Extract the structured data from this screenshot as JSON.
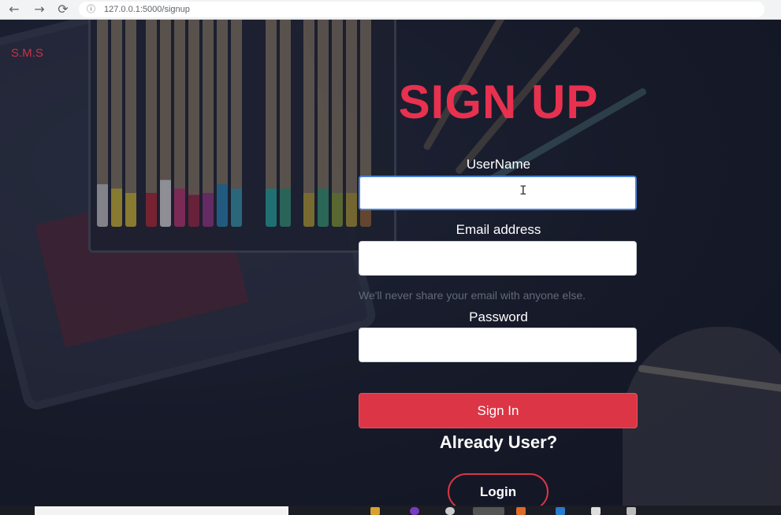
{
  "browser": {
    "url": "127.0.0.1:5000/signup",
    "back_icon": "←",
    "forward_icon": "→",
    "reload_icon": "⟳",
    "info_icon": "ⓘ"
  },
  "brand": "S.M.S",
  "title": "SIGN UP",
  "form": {
    "username_label": "UserName",
    "username_value": "",
    "email_label": "Email address",
    "email_value": "",
    "email_help": "We'll never share your email with anyone else.",
    "password_label": "Password",
    "password_value": "",
    "submit_label": "Sign In",
    "already_user": "Already User?",
    "login_label": "Login"
  },
  "colors": {
    "accent": "#dc3545",
    "title": "#e8314f",
    "background": "#1c2030"
  }
}
